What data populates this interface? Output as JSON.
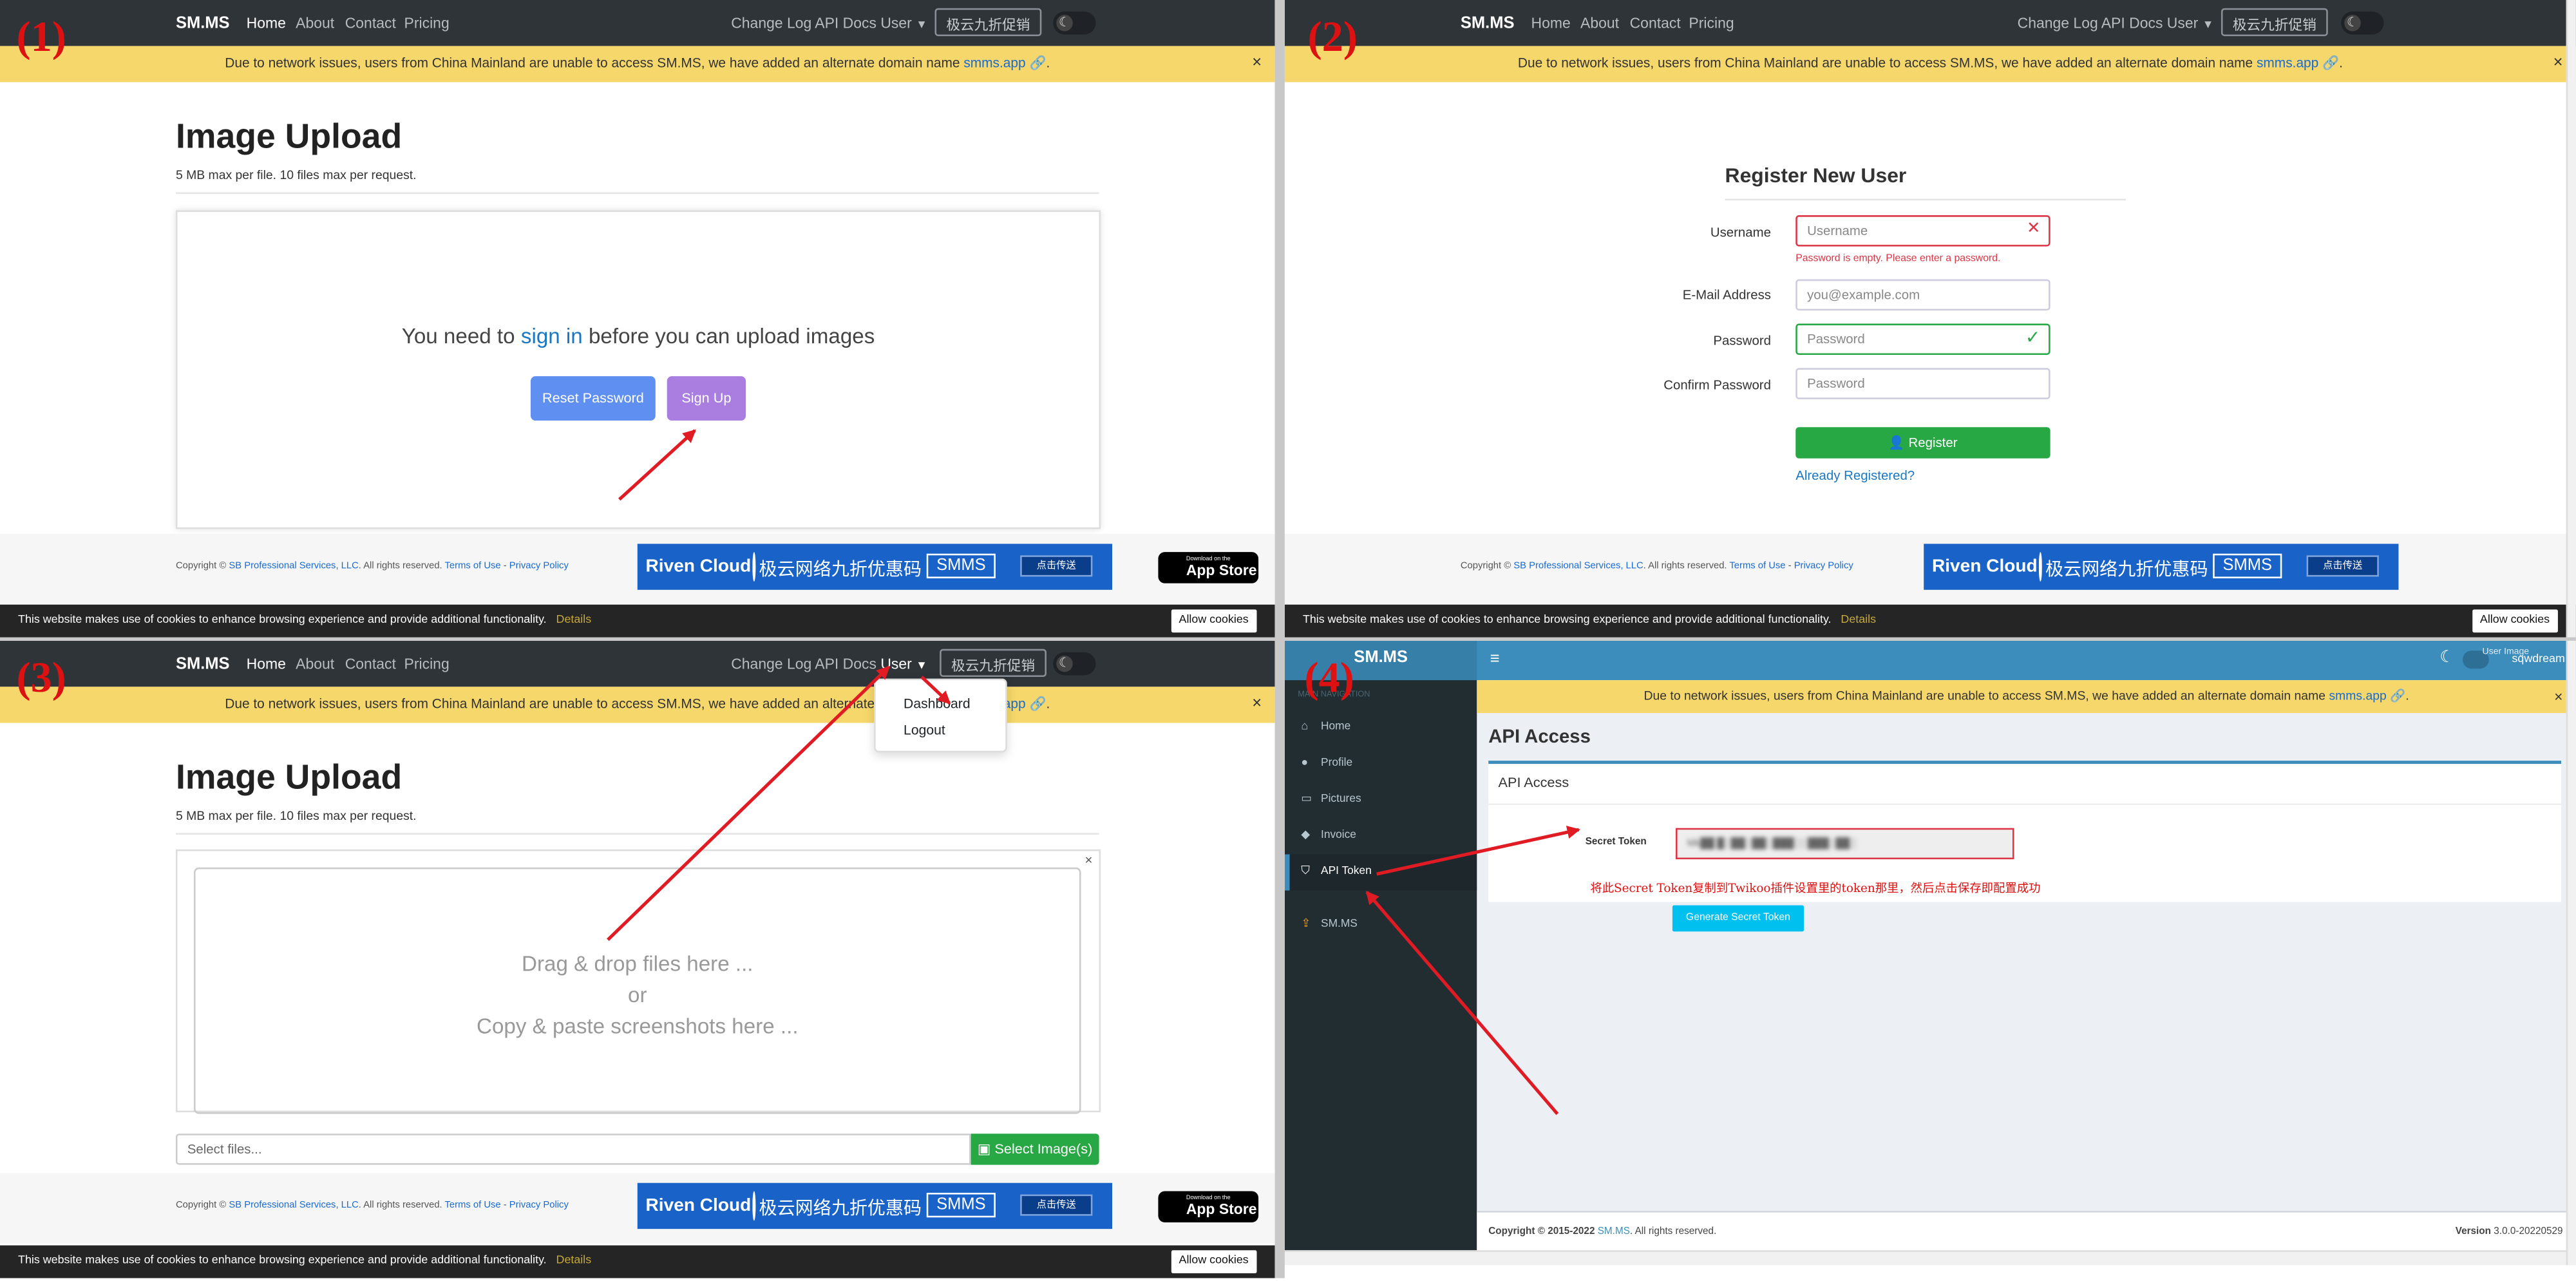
{
  "brand": "SM.MS",
  "nav": {
    "home": "Home",
    "about": "About",
    "contact": "Contact",
    "pricing": "Pricing",
    "changelog": "Change Log",
    "apidocs": "API Docs",
    "user": "User",
    "promo": "极云九折促销"
  },
  "banner": {
    "text": "Due to network issues, users from China Mainland are unable to access SM.MS, we have added an alternate domain name",
    "link": "smms.app",
    "close": "×"
  },
  "step_labels": [
    "(1)",
    "(2)",
    "(3)",
    "(4)"
  ],
  "upload": {
    "title": "Image Upload",
    "subtitle": "5 MB max per file. 10 files max per request.",
    "msg_before": "You need to",
    "msg_link": "sign in",
    "msg_after": "before you can upload images",
    "reset": "Reset Password",
    "signup": "Sign Up"
  },
  "register": {
    "title": "Register New User",
    "username_label": "Username",
    "username_ph": "Username",
    "username_err": "Password is empty. Please enter a password.",
    "email_label": "E-Mail Address",
    "email_ph": "you@example.com",
    "password_label": "Password",
    "password_ph": "Password",
    "confirm_label": "Confirm Password",
    "confirm_ph": "Password",
    "button": "Register",
    "already": "Already Registered?"
  },
  "dropdown": {
    "dashboard": "Dashboard",
    "logout": "Logout"
  },
  "dropzone": {
    "line1": "Drag & drop files here ...",
    "line2": "or",
    "line3": "Copy & paste screenshots here ...",
    "close": "×"
  },
  "file_input": {
    "placeholder": "Select files...",
    "button": "Select Image(s)"
  },
  "footer": {
    "copyright": "Copyright ©",
    "company": "SB Professional Services, LLC",
    "rights": ". All rights reserved.",
    "terms": "Terms of Use",
    "dash": " - ",
    "privacy": "Privacy Policy"
  },
  "ad": {
    "brand": "Riven Cloud",
    "slogan": "极云网络九折优惠码",
    "code": "SMMS",
    "cta": "点击传送"
  },
  "appstore": {
    "line1": "Download on the",
    "line2": "App Store"
  },
  "cookie": {
    "text": "This website makes use of cookies to enhance browsing experience and provide additional functionality.",
    "details": "Details",
    "allow": "Allow cookies"
  },
  "admin": {
    "logo": "SM.MS",
    "nav_header": "MAIN NAVIGATION",
    "menu": [
      "Home",
      "Profile",
      "Pictures",
      "Invoice",
      "API Token",
      "SM.MS"
    ],
    "user": "sqwdream",
    "user_img": "User Image",
    "page_title": "API Access",
    "box_title": "API Access",
    "token_label": "Secret Token",
    "token_value": "Mk██ █░██░██░███░░███░██░",
    "generate": "Generate Secret Token",
    "note": "将此Secret Token复制到Twikoo插件设置里的token那里，然后点击保存即配置成功",
    "footer_copy": "Copyright © 2015-2022",
    "footer_brand": "SM.MS",
    "footer_rights": ". All rights reserved.",
    "version_label": "Version",
    "version": "3.0.0-20220529"
  },
  "colors": {
    "navbar": "#2f3439",
    "banner": "#f5d76b",
    "signup": "#a97ee0",
    "reset": "#5f8ff0",
    "success": "#28a745",
    "admin_accent": "#3c8dbc",
    "annotation": "#e01b24"
  }
}
